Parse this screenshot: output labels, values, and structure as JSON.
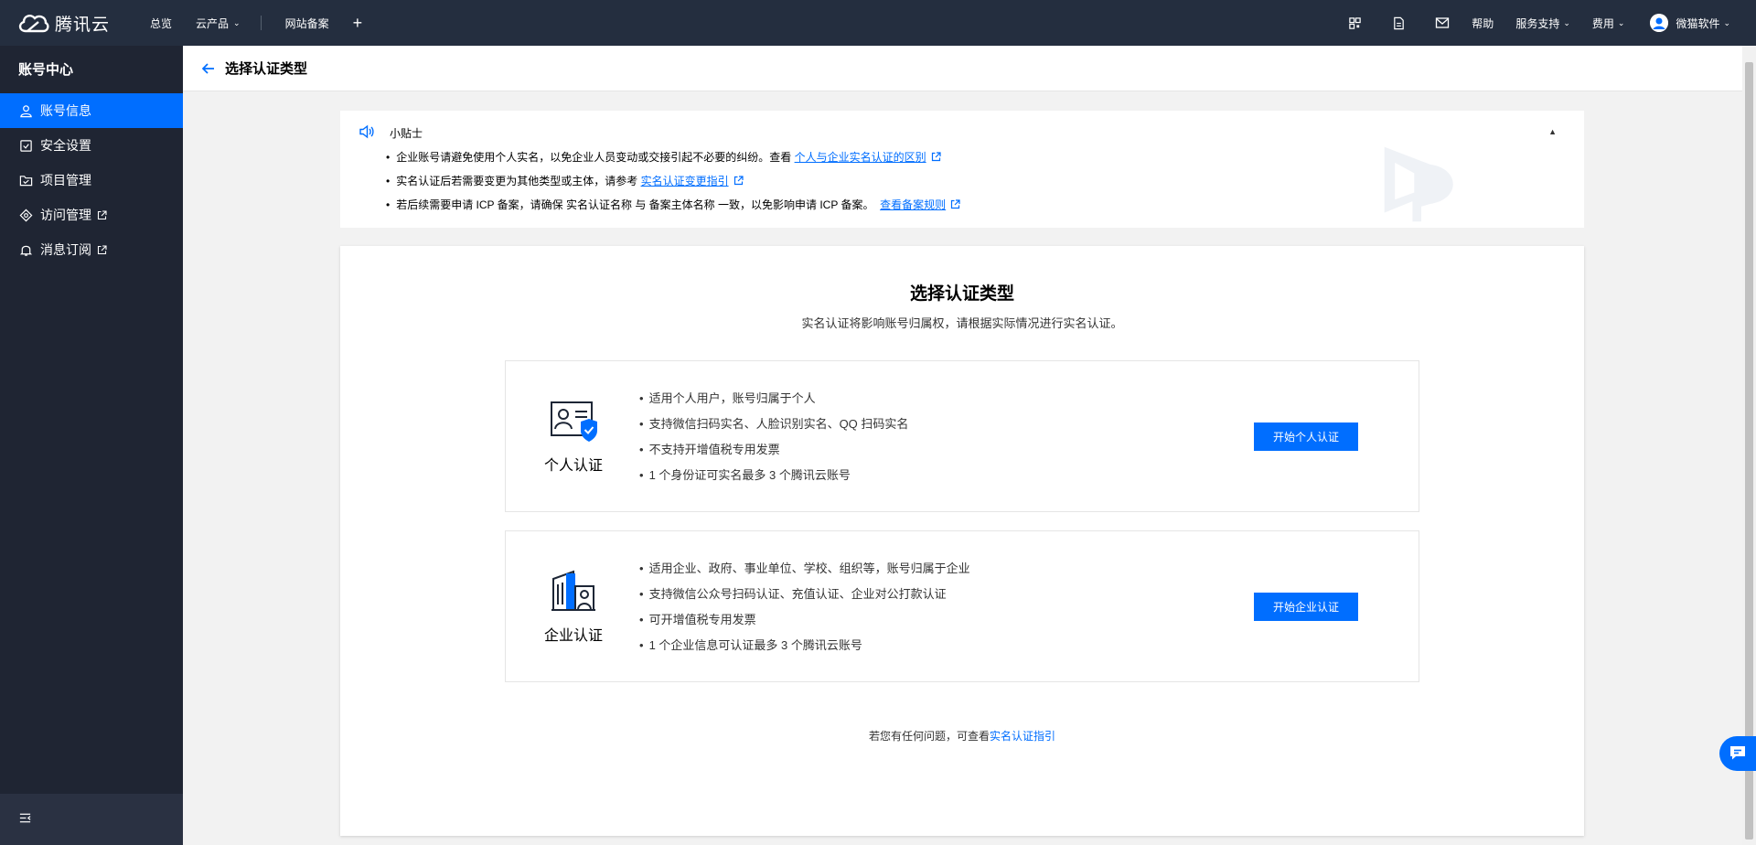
{
  "topbar": {
    "brand": "腾讯云",
    "nav": {
      "overview": "总览",
      "products": "云产品",
      "icp": "网站备案"
    },
    "right": {
      "help": "帮助",
      "support": "服务支持",
      "billing": "费用",
      "username": "微猫软件"
    }
  },
  "sidebar": {
    "title": "账号中心",
    "items": [
      {
        "label": "账号信息"
      },
      {
        "label": "安全设置"
      },
      {
        "label": "项目管理"
      },
      {
        "label": "访问管理"
      },
      {
        "label": "消息订阅"
      }
    ]
  },
  "header": {
    "title": "选择认证类型"
  },
  "tips": {
    "label": "小贴士",
    "items": [
      {
        "text": "企业账号请避免使用个人实名，以免企业人员变动或交接引起不必要的纠纷。查看",
        "link": "个人与企业实名认证的区别"
      },
      {
        "text": "实名认证后若需要变更为其他类型或主体，请参考",
        "link": "实名认证变更指引"
      },
      {
        "text": "若后续需要申请 ICP 备案，请确保 实名认证名称 与 备案主体名称 一致，以免影响申请 ICP 备案。",
        "link": "查看备案规则"
      }
    ]
  },
  "main": {
    "title": "选择认证类型",
    "subtitle": "实名认证将影响账号归属权，请根据实际情况进行实名认证。",
    "personal": {
      "name": "个人认证",
      "features": [
        "适用个人用户，账号归属于个人",
        "支持微信扫码实名、人脸识别实名、QQ 扫码实名",
        "不支持开增值税专用发票",
        "1 个身份证可实名最多 3 个腾讯云账号"
      ],
      "button": "开始个人认证"
    },
    "enterprise": {
      "name": "企业认证",
      "features": [
        "适用企业、政府、事业单位、学校、组织等，账号归属于企业",
        "支持微信公众号扫码认证、充值认证、企业对公打款认证",
        "可开增值税专用发票",
        "1 个企业信息可认证最多 3 个腾讯云账号"
      ],
      "button": "开始企业认证"
    },
    "footer": {
      "text": "若您有任何问题，可查看",
      "link": "实名认证指引"
    }
  },
  "colors": {
    "primary": "#006eff",
    "topbar": "#242e3f",
    "sidebar": "#1f2533"
  }
}
